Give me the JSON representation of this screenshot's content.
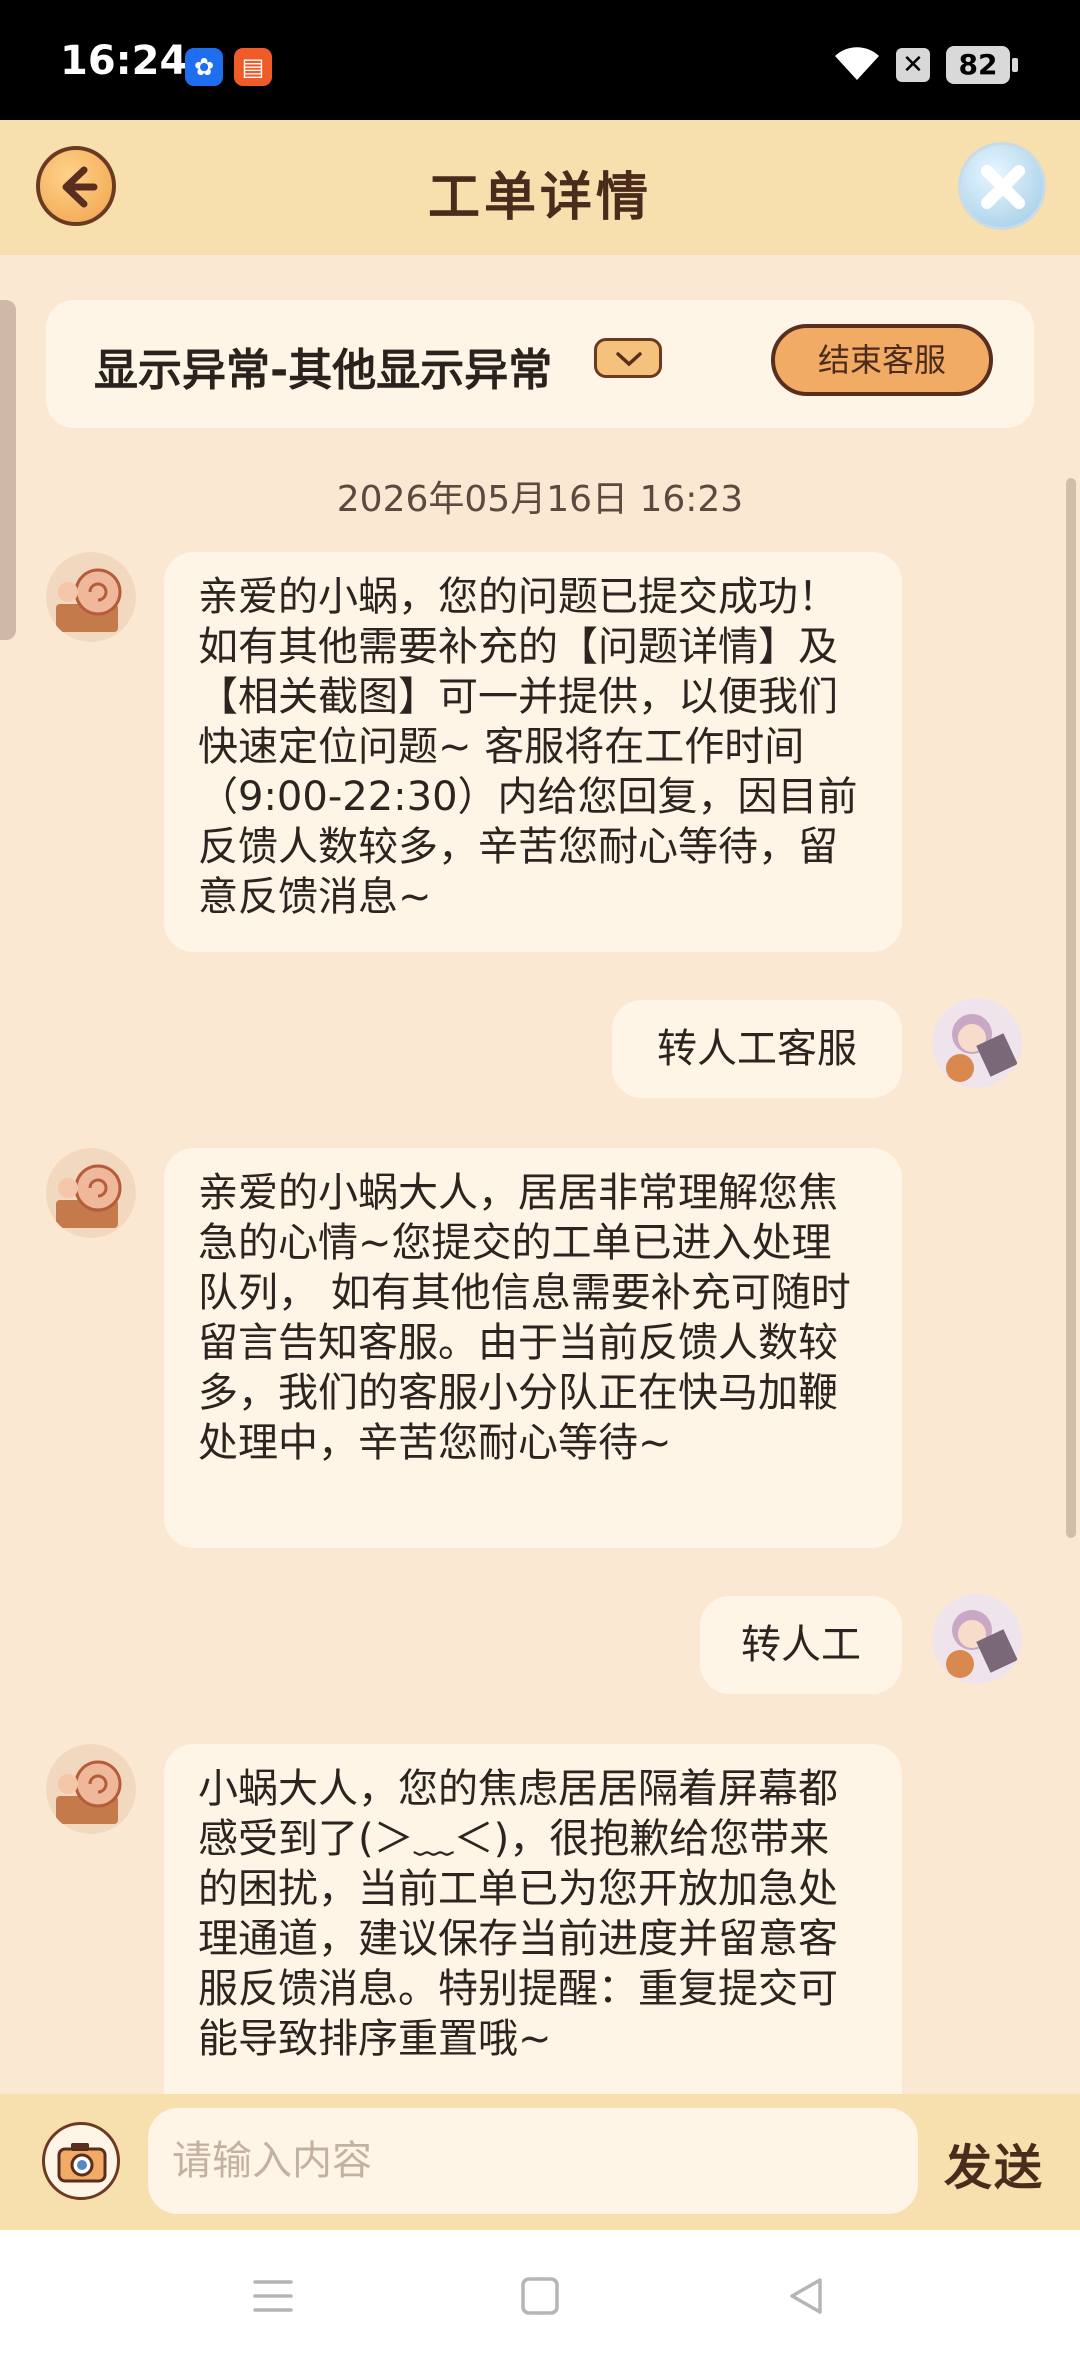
{
  "status_bar": {
    "time": "16:24",
    "battery": "82"
  },
  "header": {
    "title": "工单详情"
  },
  "topic": {
    "title": "显示异常-其他显示异常",
    "end_button": "结束客服"
  },
  "chat": {
    "timestamp": "2026年05月16日 16:23",
    "messages": [
      {
        "side": "left",
        "text": "亲爱的小蜗，您的问题已提交成功！ 如有其他需要补充的【问题详情】及【相关截图】可一并提供，以便我们快速定位问题~ 客服将在工作时间（9:00-22:30）内给您回复，因目前反馈人数较多，辛苦您耐心等待，留意反馈消息~"
      },
      {
        "side": "right",
        "text": "转人工客服"
      },
      {
        "side": "left",
        "text": "亲爱的小蜗大人，居居非常理解您焦急的心情~您提交的工单已进入处理队列， 如有其他信息需要补充可随时留言告知客服。由于当前反馈人数较多，我们的客服小分队正在快马加鞭处理中，辛苦您耐心等待~"
      },
      {
        "side": "right",
        "text": "转人工"
      },
      {
        "side": "left",
        "text": "小蜗大人，您的焦虑居居隔着屏幕都感受到了(＞﹏＜)，很抱歉给您带来的困扰，当前工单已为您开放加急处理通道，建议保存当前进度并留意客服反馈消息。特别提醒：重复提交可能导致排序重置哦~"
      }
    ]
  },
  "input": {
    "placeholder": "请输入内容",
    "send_label": "发送"
  },
  "colors": {
    "background": "#fbe8d2",
    "header": "#f8dfae",
    "bubble": "#fff5e6",
    "accent": "#f2ab64",
    "brown": "#5a2e1e"
  }
}
